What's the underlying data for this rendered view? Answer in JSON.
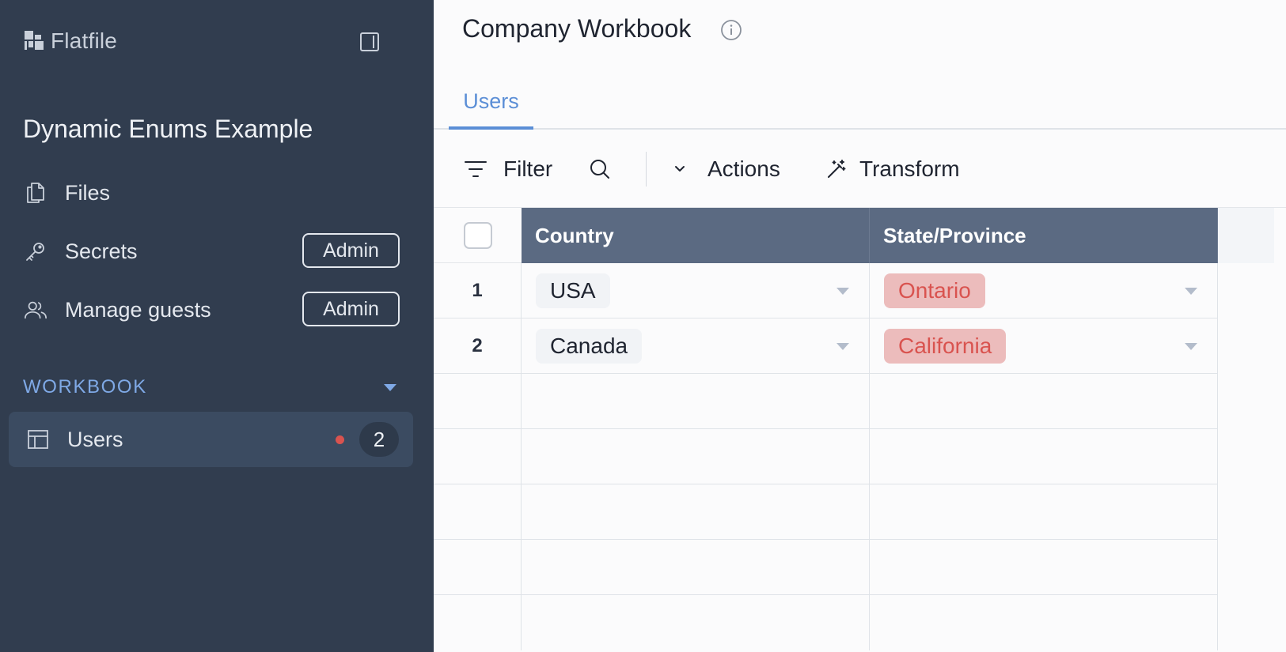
{
  "sidebar": {
    "brand": "Flatfile",
    "space_title": "Dynamic Enums Example",
    "nav": [
      {
        "label": "Files",
        "icon": "files-icon"
      },
      {
        "label": "Secrets",
        "icon": "key-icon",
        "badge": "Admin"
      },
      {
        "label": "Manage guests",
        "icon": "users-icon",
        "badge": "Admin"
      }
    ],
    "section_label": "WORKBOOK",
    "sheets": [
      {
        "label": "Users",
        "icon": "table-icon",
        "count": "2",
        "has_errors": true
      }
    ]
  },
  "main": {
    "workbook_title": "Company Workbook",
    "tabs": [
      {
        "label": "Users",
        "active": true
      }
    ],
    "toolbar": {
      "filter_label": "Filter",
      "actions_label": "Actions",
      "transform_label": "Transform"
    },
    "table": {
      "columns": [
        "Country",
        "State/Province"
      ],
      "rows": [
        {
          "num": "1",
          "country": "USA",
          "state": "Ontario",
          "state_error": true
        },
        {
          "num": "2",
          "country": "Canada",
          "state": "California",
          "state_error": true
        }
      ]
    }
  },
  "colors": {
    "sidebar_bg": "#313d4f",
    "accent": "#5b8ed6",
    "header_bg": "#5b6a82",
    "error_chip_bg": "#ecbcbc",
    "error_text": "#d9534f"
  }
}
